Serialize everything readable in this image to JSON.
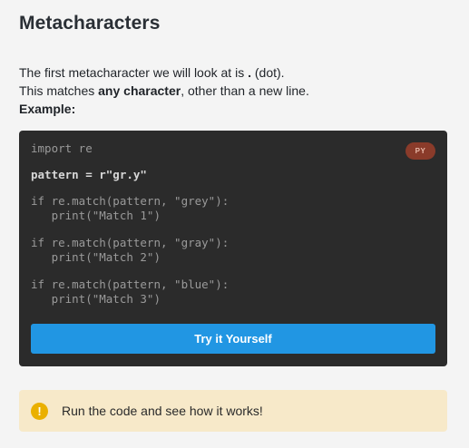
{
  "heading": "Metacharacters",
  "intro": {
    "line1_pre": "The first metacharacter we will look at is ",
    "line1_bold": ".",
    "line1_post": " (dot).",
    "line2_pre": "This matches ",
    "line2_bold": "any character",
    "line2_post": ", other than a new line.",
    "example_label": "Example:"
  },
  "code": {
    "language_badge": "PY",
    "lines": [
      "import re",
      "pattern = r\"gr.y\"",
      "if re.match(pattern, \"grey\"):",
      "   print(\"Match 1\")",
      "if re.match(pattern, \"gray\"):",
      "   print(\"Match 2\")",
      "if re.match(pattern, \"blue\"):",
      "   print(\"Match 3\")"
    ],
    "try_button_label": "Try it Yourself"
  },
  "tip": {
    "icon": "exclamation-icon",
    "icon_glyph": "!",
    "text": "Run the code and see how it works!"
  },
  "colors": {
    "code_background": "#2b2b2b",
    "button": "#2196e3",
    "badge": "#8a3b2a",
    "tip_background": "#f7e9c9",
    "tip_icon": "#eab000"
  }
}
